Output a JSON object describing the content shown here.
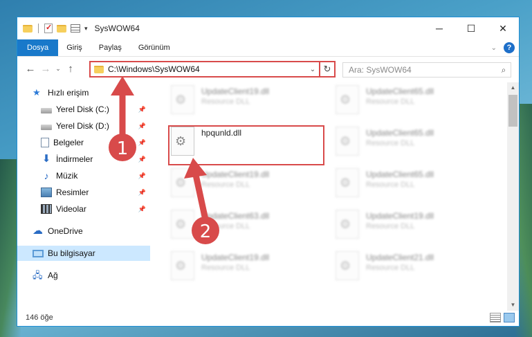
{
  "window": {
    "title": "SysWOW64",
    "controls": {
      "minimize": "─",
      "maximize": "☐",
      "close": "✕"
    }
  },
  "ribbon": {
    "tabs": [
      "Dosya",
      "Giriş",
      "Paylaş",
      "Görünüm"
    ],
    "help": "?"
  },
  "navigation": {
    "back": "←",
    "forward": "→",
    "recent": "⌄",
    "up": "↑",
    "address": "C:\\Windows\\SysWOW64",
    "refresh": "↻",
    "search_placeholder": "Ara: SysWOW64"
  },
  "sidebar": {
    "items": [
      {
        "label": "Hızlı erişim",
        "icon": "star-icon"
      },
      {
        "label": "Yerel Disk (C:)",
        "icon": "disk-icon",
        "pinned": true
      },
      {
        "label": "Yerel Disk (D:)",
        "icon": "disk-icon",
        "pinned": true
      },
      {
        "label": "Belgeler",
        "icon": "document-icon",
        "pinned": true
      },
      {
        "label": "İndirmeler",
        "icon": "download-icon",
        "pinned": true
      },
      {
        "label": "Müzik",
        "icon": "music-icon",
        "pinned": true
      },
      {
        "label": "Resimler",
        "icon": "pictures-icon",
        "pinned": true
      },
      {
        "label": "Videolar",
        "icon": "video-icon",
        "pinned": true
      },
      {
        "label": "OneDrive",
        "icon": "cloud-icon"
      },
      {
        "label": "Bu bilgisayar",
        "icon": "computer-icon",
        "selected": true
      },
      {
        "label": "Ağ",
        "icon": "network-icon"
      }
    ]
  },
  "files": {
    "highlighted": {
      "name": "hpqunld.dll"
    },
    "blurred": [
      {
        "name": "UpdateClient19.dll",
        "type": "Resource DLL"
      },
      {
        "name": "UpdateClient65.dll",
        "type": "Resource DLL"
      },
      {
        "name": "UpdateClient65.dll",
        "type": "Resource DLL"
      },
      {
        "name": "UpdateClient19.dll",
        "type": "Resource DLL"
      },
      {
        "name": "UpdateClient65.dll",
        "type": "Resource DLL"
      },
      {
        "name": "UpdateClient63.dll",
        "type": "Resource DLL"
      },
      {
        "name": "UpdateClient19.dll",
        "type": "Resource DLL"
      },
      {
        "name": "UpdateClient19.dll",
        "type": "Resource DLL"
      },
      {
        "name": "UpdateClient21.dll",
        "type": "Resource DLL"
      }
    ]
  },
  "annotations": {
    "step1": "1",
    "step2": "2",
    "color": "#d84a4a"
  },
  "status": {
    "item_count": "146 öğe"
  }
}
